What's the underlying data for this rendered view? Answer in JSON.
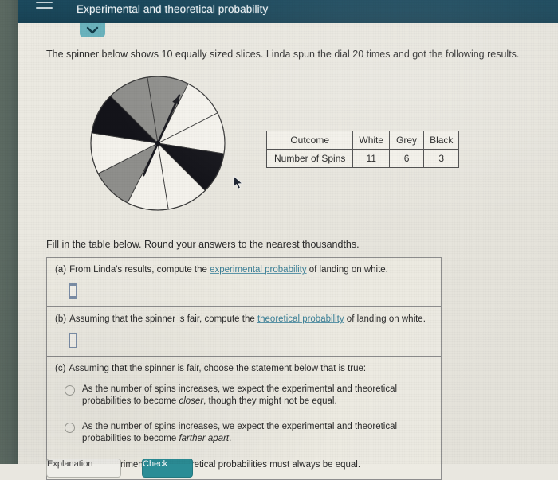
{
  "header": {
    "title": "Experimental and theoretical probability",
    "menu_icon": "hamburger-icon",
    "chevron_icon": "chevron-down-icon",
    "background_color": "#1c4a5e",
    "chevron_tab_color": "#6bb3bd"
  },
  "main": {
    "intro_text": "The spinner below shows 10 equally sized slices. Linda spun the dial 20 times and got the following results.",
    "fill_in_text": "Fill in the table below. Round your answers to the nearest thousandths."
  },
  "spinner": {
    "total_slices": 10,
    "colors": {
      "white": "#f4f2ec",
      "grey": "#8f8f8c",
      "black": "#14141a",
      "outline": "#3a3a3a"
    },
    "rotation_offset_deg": -9,
    "slices": [
      "grey",
      "white",
      "white",
      "black",
      "white",
      "white",
      "grey",
      "white",
      "black",
      "grey"
    ],
    "needle_angle_deg": 24,
    "needle_color": "#1a1a20"
  },
  "results_table": {
    "headers": [
      "Outcome",
      "White",
      "Grey",
      "Black"
    ],
    "row_label": "Number of Spins",
    "values": [
      "11",
      "6",
      "3"
    ]
  },
  "questions": [
    {
      "marker": "(a)",
      "text_before": "From Linda's results, compute the ",
      "link": "experimental probability",
      "text_after": " of landing on white.",
      "answer_value": "",
      "has_cursor": true
    },
    {
      "marker": "(b)",
      "text_before": "Assuming that the spinner is fair, compute the ",
      "link": "theoretical probability",
      "text_after": " of landing on white.",
      "answer_value": "",
      "has_cursor": false
    }
  ],
  "question_c": {
    "marker": "(c)",
    "text": "Assuming that the spinner is fair, choose the statement below that is true:",
    "choices": [
      {
        "part1": "As the number of spins increases, we expect the experimental and theoretical probabilities to become ",
        "emphasis": "closer",
        "part2": ", though they might not be equal.",
        "selected": false
      },
      {
        "part1": "As the number of spins increases, we expect the experimental and theoretical probabilities to become ",
        "emphasis": "farther apart",
        "part2": ".",
        "selected": false
      },
      {
        "part1": "The experimental and theoretical probabilities must always be equal.",
        "emphasis": "",
        "part2": "",
        "selected": false
      }
    ]
  },
  "footer": {
    "explanation_label": "Explanation",
    "check_label": "Check",
    "check_color": "#2b8d96"
  }
}
